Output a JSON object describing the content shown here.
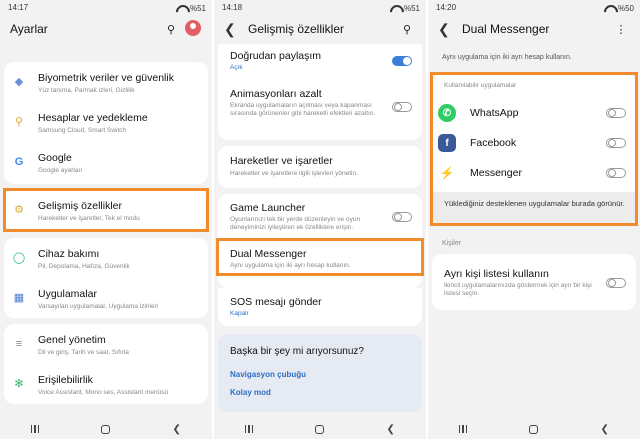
{
  "colors": {
    "accent": "#2b6fc4",
    "highlight": "#f28a2e",
    "toggle_on": "#3c7fd6",
    "whatsapp": "#2ecc63",
    "facebook": "#3b5998",
    "messenger": "#1a8cf0"
  },
  "panel1": {
    "status": {
      "time": "14:17",
      "battery": "%51"
    },
    "title": "Ayarlar",
    "items": [
      {
        "icon": "shield-icon",
        "title": "Biyometrik veriler ve güvenlik",
        "sub": "Yüz tanıma, Parmak izleri, Gizlilik"
      },
      {
        "icon": "key-icon",
        "title": "Hesaplar ve yedekleme",
        "sub": "Samsung Cloud, Smart Switch"
      },
      {
        "icon": "google-icon",
        "title": "Google",
        "sub": "Google ayarları"
      },
      {
        "icon": "gear-plus-icon",
        "title": "Gelişmiş özellikler",
        "sub": "Hareketler ve işaretler, Tek el modu"
      },
      {
        "icon": "device-care-icon",
        "title": "Cihaz bakımı",
        "sub": "Pil, Depolama, Hafıza, Güvenlik"
      },
      {
        "icon": "apps-grid-icon",
        "title": "Uygulamalar",
        "sub": "Varsayılan uygulamalar, Uygulama izinleri"
      },
      {
        "icon": "sliders-icon",
        "title": "Genel yönetim",
        "sub": "Dil ve giriş, Tarih ve saat, Sıfırla"
      },
      {
        "icon": "accessibility-icon",
        "title": "Erişilebilirlik",
        "sub": "Voice Assistant, Mono ses, Assistant menüsü"
      }
    ]
  },
  "panel2": {
    "status": {
      "time": "14:18",
      "battery": "%51"
    },
    "title": "Gelişmiş özellikler",
    "direct_share": {
      "title": "Doğrudan paylaşım",
      "sub": "Açık"
    },
    "animations": {
      "title": "Animasyonları azalt",
      "sub": "Ekranda uygulamaların açılması veya kapanması sırasında görünenler gibi hareketli efektleri azaltın."
    },
    "motions": {
      "title": "Hareketler ve işaretler",
      "sub": "Hareketler ve işaretlere ilgili işlevleri yönetin."
    },
    "game_launcher": {
      "title": "Game Launcher",
      "sub": "Oyunlarınızı tek bir yerde düzenleyin ve oyun deneyiminizi iyileştiren ek özelliklere erişin."
    },
    "dual_messenger": {
      "title": "Dual Messenger",
      "sub": "Aynı uygulama için iki ayrı hesap kullanın."
    },
    "sos": {
      "title": "SOS mesajı gönder",
      "sub": "Kapalı"
    },
    "suggestions": {
      "heading": "Başka bir şey mi arıyorsunuz?",
      "links": [
        "Navigasyon çubuğu",
        "Kolay mod"
      ]
    }
  },
  "panel3": {
    "status": {
      "time": "14:20",
      "battery": "%50"
    },
    "title": "Dual Messenger",
    "intro": "Aynı uygulama için iki ayrı hesap kullanın.",
    "available_label": "Kullanılabilir uygulamalar",
    "apps": [
      {
        "name": "WhatsApp",
        "icon": "whatsapp-icon"
      },
      {
        "name": "Facebook",
        "icon": "facebook-icon"
      },
      {
        "name": "Messenger",
        "icon": "messenger-icon"
      }
    ],
    "note": "Yüklediğiniz desteklenen uygulamalar burada görünür.",
    "contacts_label": "Kişiler",
    "separate_contacts": {
      "title": "Ayrı kişi listesi kullanın",
      "sub": "İkincil uygulamalarınızda göstermek için ayrı bir kişi listesi seçin."
    }
  }
}
